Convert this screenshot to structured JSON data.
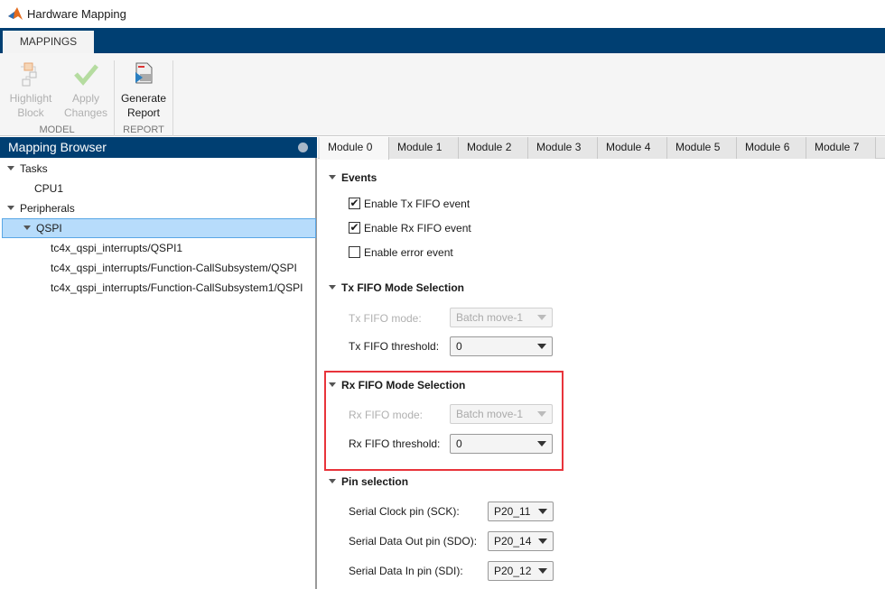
{
  "window": {
    "title": "Hardware Mapping",
    "icon": "matlab-logo-icon"
  },
  "ribbon": {
    "tab": "MAPPINGS",
    "groups": [
      {
        "label": "MODEL",
        "buttons": [
          {
            "line1": "Highlight",
            "line2": "Block",
            "icon": "highlight-block-icon",
            "enabled": false
          },
          {
            "line1": "Apply",
            "line2": "Changes",
            "icon": "checkmark-icon",
            "enabled": false
          }
        ]
      },
      {
        "label": "REPORT",
        "buttons": [
          {
            "line1": "Generate",
            "line2": "Report",
            "icon": "report-icon",
            "enabled": true
          }
        ]
      }
    ]
  },
  "browser": {
    "title": "Mapping Browser",
    "tree": [
      {
        "label": "Tasks",
        "expanded": true
      },
      {
        "label": "CPU1"
      },
      {
        "label": "Peripherals",
        "expanded": true
      },
      {
        "label": "QSPI",
        "expanded": true,
        "selected": true
      },
      {
        "label": "tc4x_qspi_interrupts/QSPI1"
      },
      {
        "label": "tc4x_qspi_interrupts/Function-CallSubsystem/QSPI"
      },
      {
        "label": "tc4x_qspi_interrupts/Function-CallSubsystem1/QSPI"
      }
    ]
  },
  "tabs": [
    "Module 0",
    "Module 1",
    "Module 2",
    "Module 3",
    "Module 4",
    "Module 5",
    "Module 6",
    "Module 7"
  ],
  "active_tab": "Module 0",
  "events": {
    "title": "Events",
    "items": [
      {
        "label": "Enable Tx FIFO event",
        "checked": true
      },
      {
        "label": "Enable Rx FIFO event",
        "checked": true
      },
      {
        "label": "Enable error event",
        "checked": false
      }
    ]
  },
  "tx": {
    "title": "Tx FIFO Mode Selection",
    "mode_label": "Tx FIFO mode:",
    "mode_value": "Batch move-1",
    "threshold_label": "Tx FIFO threshold:",
    "threshold_value": "0"
  },
  "rx": {
    "title": "Rx FIFO Mode Selection",
    "mode_label": "Rx FIFO mode:",
    "mode_value": "Batch move-1",
    "threshold_label": "Rx FIFO threshold:",
    "threshold_value": "0"
  },
  "pins": {
    "title": "Pin selection",
    "items": [
      {
        "label": "Serial Clock pin (SCK):",
        "value": "P20_11"
      },
      {
        "label": "Serial Data Out pin (SDO):",
        "value": "P20_14"
      },
      {
        "label": "Serial Data In pin (SDI):",
        "value": "P20_12"
      }
    ]
  },
  "colors": {
    "accent": "#003f72",
    "highlight": "#e8343b",
    "selection": "#b7dcfb"
  }
}
